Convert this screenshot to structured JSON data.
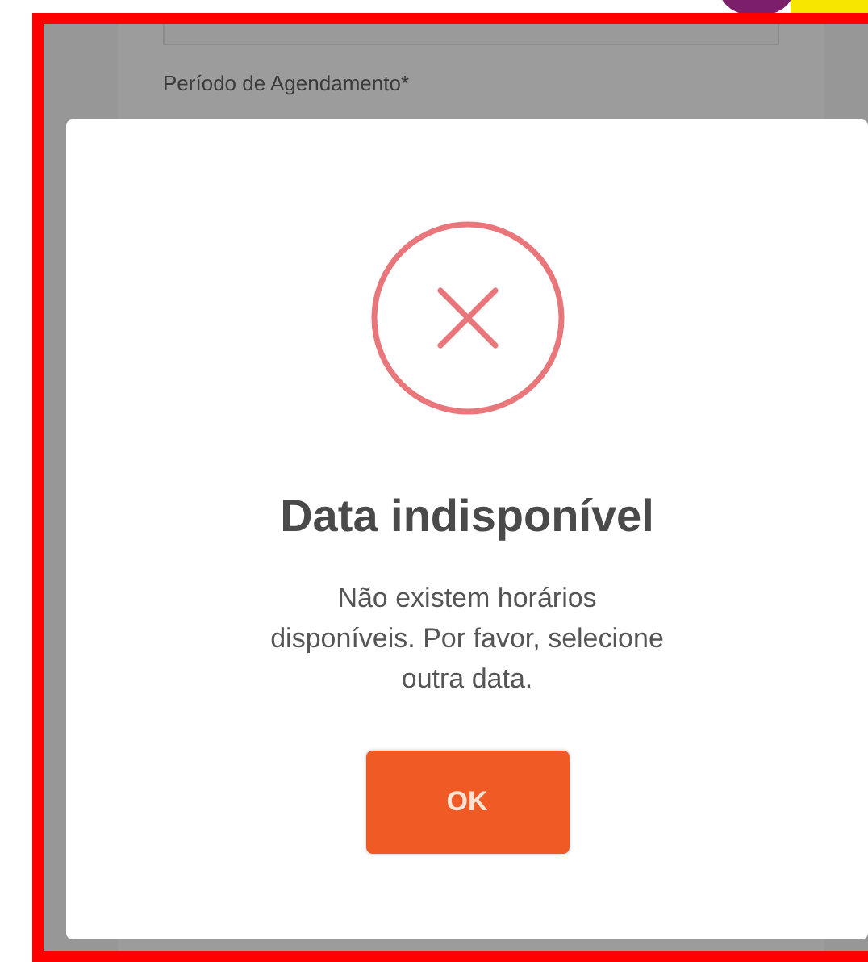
{
  "form": {
    "field_label": "Período de Agendamento*"
  },
  "dialog": {
    "title": "Data indisponível",
    "message": "Não existem horários disponíveis. Por favor, selecione outra data.",
    "buttons": [
      "OK"
    ]
  }
}
